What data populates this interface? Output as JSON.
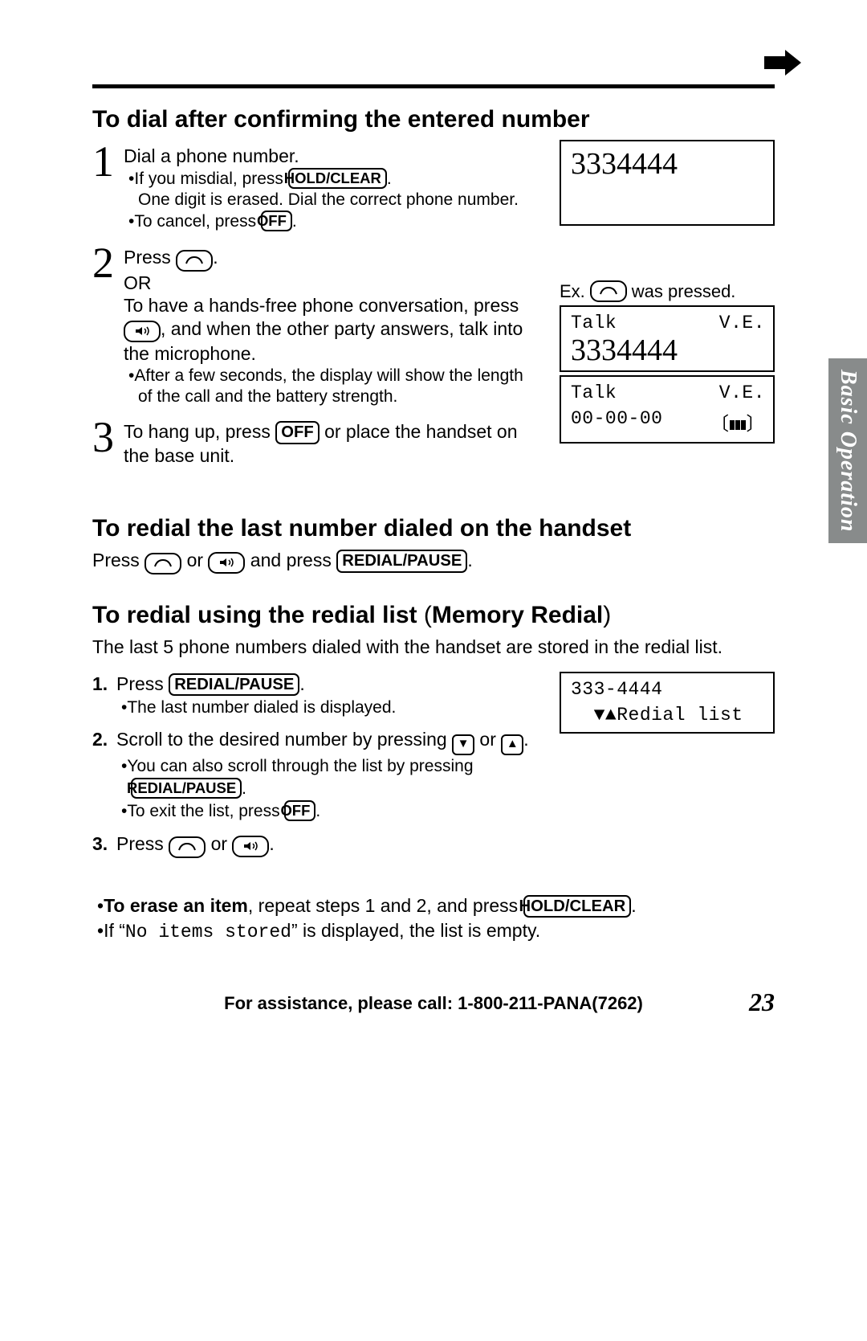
{
  "side_tab": "Basic Operation",
  "top_rule_arrow": "➡",
  "section_a": {
    "heading": "To dial after confirming the entered number",
    "step1": {
      "text": "Dial a phone number.",
      "sub1_a": "If you misdial, press ",
      "sub1_key": "HOLD/CLEAR",
      "sub1_b": ".",
      "sub1_note": "One digit is erased. Dial the correct phone number.",
      "sub2_a": "To cancel, press ",
      "sub2_key": "OFF",
      "sub2_b": ".",
      "display_number": "3334444"
    },
    "step2": {
      "line1_a": "Press ",
      "line1_b": ".",
      "or": "OR",
      "line2_a": "To have a hands-free phone conversation, press ",
      "line2_b": ", and when the other party answers, talk into the microphone.",
      "sub_a": "After a few seconds, the display will show the length of the call and the battery strength.",
      "ex_a": "Ex.",
      "ex_b": " was pressed.",
      "disp1_left": "Talk",
      "disp1_right": "V.E.",
      "disp1_num": "3334444",
      "disp2_left": "Talk",
      "disp2_right": "V.E.",
      "disp2_time": "00-00-00"
    },
    "step3": {
      "a": "To hang up, press ",
      "key": "OFF",
      "b": " or place the handset on the base unit."
    }
  },
  "section_b": {
    "heading": "To redial the last number dialed on the handset",
    "a": "Press ",
    "mid": " or ",
    "b": " and press ",
    "key": "REDIAL/PAUSE",
    "c": "."
  },
  "section_c": {
    "heading_a": "To redial using the redial list ",
    "heading_paren": "(",
    "heading_b": "Memory Redial",
    "heading_close": ")",
    "intro": "The last 5 phone numbers dialed with the handset are stored in the redial list.",
    "items": {
      "n1": "1.",
      "t1_a": "Press ",
      "t1_key": "REDIAL/PAUSE",
      "t1_b": ".",
      "t1_sub": "The last number dialed is displayed.",
      "n2": "2.",
      "t2_a": "Scroll to the desired number by pressing ",
      "t2_mid": " or ",
      "t2_b": ".",
      "t2_sub_a": "You can also scroll through the list by pressing ",
      "t2_sub_key": "REDIAL/PAUSE",
      "t2_sub_b": ".",
      "t2_exit_a": "To exit the list, press ",
      "t2_exit_key": "OFF",
      "t2_exit_b": ".",
      "n3": "3.",
      "t3_a": "Press ",
      "t3_mid": " or ",
      "t3_b": "."
    },
    "display": {
      "num": "333-4444",
      "label": "Redial list"
    },
    "erase_a": "To erase an item",
    "erase_b": ", repeat steps 1 and 2, and press ",
    "erase_key": "HOLD/CLEAR",
    "erase_c": ".",
    "empty_a": "If “",
    "empty_code": "No items stored",
    "empty_b": "” is displayed, the list is empty."
  },
  "footer": {
    "text": "For assistance, please call: 1-800-211-PANA(7262)",
    "page": "23"
  }
}
